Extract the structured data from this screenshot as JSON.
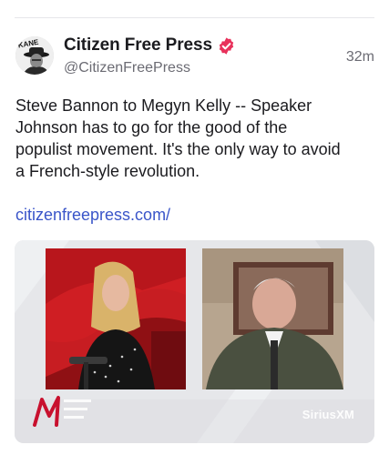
{
  "post": {
    "author": {
      "display_name": "Citizen Free Press",
      "handle": "@CitizenFreePress",
      "verified": true,
      "avatar_text": "KANE"
    },
    "timestamp": "32m",
    "text_lines": [
      "Steve Bannon to Megyn Kelly -- Speaker",
      "Johnson has to go for the good of the",
      "populist movement. It's the only way to avoid",
      "a French-style revolution."
    ],
    "link": "citizenfreepress.com/",
    "media": {
      "watermark": "SiriusXM"
    }
  },
  "colors": {
    "link": "#3a55c9",
    "verified_badge": "#e8315b",
    "text": "#1b1b1f",
    "secondary_text": "#6b6b73"
  }
}
